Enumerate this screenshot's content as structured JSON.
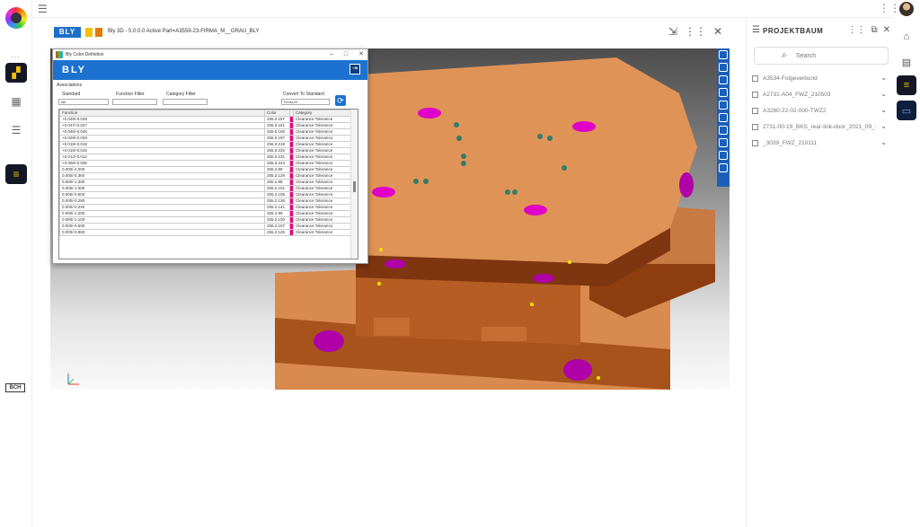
{
  "left_rail": {
    "dots": "...",
    "bch_label": "BCH"
  },
  "viewer": {
    "brand_tag": "BLY",
    "doc_title": "Bly 3D - 5.0.0.0 Active Part=A3559-23-FIRMA_M__GRAU_BLY"
  },
  "dialog": {
    "window_title": "Bly Color Definition",
    "brand_logo": "BLY",
    "tab": "Associations",
    "standard_label": "Standard",
    "standard_value": "fall",
    "function_filter_label": "Function Filter",
    "category_filter_label": "Category Filter",
    "convert_label": "Convert To Standard",
    "convert_value": "Firma M",
    "columns": [
      "Function",
      "Color",
      "Category"
    ],
    "rows": [
      [
        "+0.049/-0.049",
        "255.0.157",
        "Clearance Tolerance"
      ],
      [
        "+0.047/-0.047",
        "255.0.161",
        "Clearance Tolerance"
      ],
      [
        "+0.045/-0.045",
        "255.0.165",
        "Clearance Tolerance"
      ],
      [
        "+0.029/-0.029",
        "255.0.197",
        "Clearance Tolerance"
      ],
      [
        "+0.018/-0.018",
        "255.0.219",
        "Clearance Tolerance"
      ],
      [
        "+0.015/-0.015",
        "255.0.225",
        "Clearance Tolerance"
      ],
      [
        "+0.012/-0.012",
        "255.0.231",
        "Clearance Tolerance"
      ],
      [
        "+0.006/-0.006",
        "255.0.243",
        "Clearance Tolerance"
      ],
      [
        "0.000/-4.000",
        "255.2.89",
        "Clearance Tolerance"
      ],
      [
        "0.000/-0.360",
        "255.2.129",
        "Clearance Tolerance"
      ],
      [
        "0.000/-1.300",
        "255.2.98",
        "Clearance Tolerance"
      ],
      [
        "0.000/-1.000",
        "255.2.101",
        "Clearance Tolerance"
      ],
      [
        "0.000/-0.600",
        "255.2.105",
        "Clearance Tolerance"
      ],
      [
        "0.000/-0.280",
        "255.2.136",
        "Clearance Tolerance"
      ],
      [
        "0.000/-0.240",
        "255.2.141",
        "Clearance Tolerance"
      ],
      [
        "0.000/-1.200",
        "255.2.99",
        "Clearance Tolerance"
      ],
      [
        "0.000/-1.100",
        "255.2.100",
        "Clearance Tolerance"
      ],
      [
        "0.000/-0.500",
        "255.2.107",
        "Clearance Tolerance"
      ],
      [
        "0.000/-0.860",
        "255.2.126",
        "Clearance Tolerance"
      ]
    ],
    "swatch_color": "#e6007e"
  },
  "projektbaum": {
    "title": "PROJEKTBAUM",
    "search_placeholder": "Search",
    "items": [
      "A3534-Folgeverbund",
      "A2731-Ä04_FWZ_210503",
      "A3260-22-02-000-TWZ2",
      "2731-00-19_BKS_rear-link-door_2021_09_10",
      "_3039_FWZ_210111"
    ]
  },
  "colors": {
    "accent_blue": "#1d72cf",
    "rail_dark": "#141826",
    "plate_orange": "#d98a4e",
    "feature_magenta": "#e000c8"
  }
}
